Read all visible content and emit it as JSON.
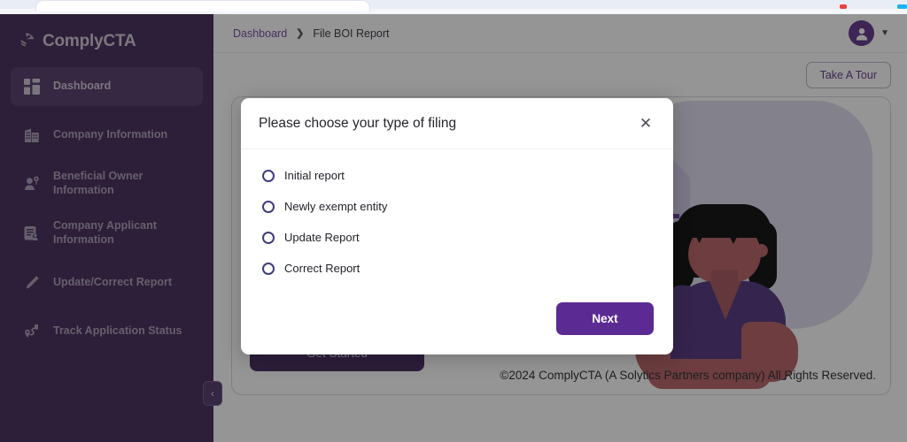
{
  "browser": {
    "tab_placeholder": ""
  },
  "sidebar": {
    "brand": "ComplyCTA",
    "brand_icon": "comply-logo-icon",
    "collapse_icon": "chevron-left-icon",
    "items": [
      {
        "label": "Dashboard",
        "icon": "dashboard-grid-icon",
        "active": true
      },
      {
        "label": "Company Information",
        "icon": "building-icon",
        "active": false
      },
      {
        "label": "Beneficial Owner Information",
        "icon": "person-pin-icon",
        "active": false
      },
      {
        "label": "Company Applicant Information",
        "icon": "document-person-icon",
        "active": false
      },
      {
        "label": "Update/Correct Report",
        "icon": "pencil-icon",
        "active": false
      },
      {
        "label": "Track Application Status",
        "icon": "route-pin-icon",
        "active": false
      }
    ]
  },
  "topbar": {
    "breadcrumb_root": "Dashboard",
    "breadcrumb_separator": "❯",
    "breadcrumb_current": "File BOI Report",
    "avatar_icon": "user-avatar-icon",
    "avatar_chevron_icon": "chevron-down-icon"
  },
  "content": {
    "tour_button": "Take A Tour",
    "get_started_button": "Get Started",
    "copyright": "©2024 ComplyCTA (A Solytics Partners company) All Rights Reserved.",
    "illustration_name": "woman-with-document-illustration"
  },
  "modal": {
    "title": "Please choose your type of filing",
    "close_icon": "close-icon",
    "options": [
      {
        "label": "Initial report",
        "selected": false
      },
      {
        "label": "Newly exempt entity",
        "selected": false
      },
      {
        "label": "Update Report",
        "selected": false
      },
      {
        "label": "Correct Report",
        "selected": false
      }
    ],
    "next_button": "Next"
  },
  "colors": {
    "sidebar_bg": "#3b1f52",
    "sidebar_active": "#4c3063",
    "brand_text": "#cfc7d6",
    "accent_purple": "#5b2b93",
    "breadcrumb_link": "#6b3fa0",
    "get_started_bg": "#3c1d55",
    "radio_outline": "#3f3d7a",
    "overlay": "rgba(30,30,30,0.47)"
  }
}
